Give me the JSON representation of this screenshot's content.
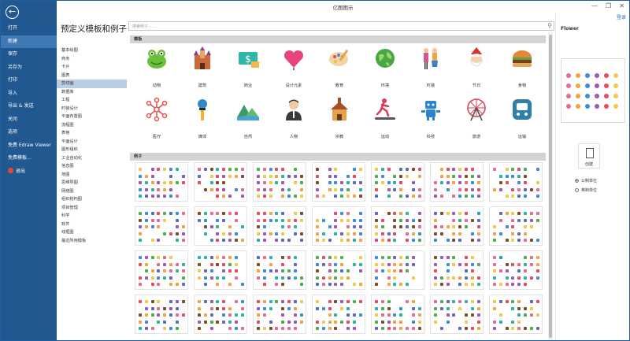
{
  "window": {
    "title": "亿图图示",
    "minimize_label": "—",
    "maximize_label": "❐",
    "close_label": "✕",
    "signin_label": "登录"
  },
  "sidebar": {
    "items": [
      {
        "label": "打开"
      },
      {
        "label": "新建",
        "selected": true
      },
      {
        "label": "保存"
      },
      {
        "label": "另存为"
      },
      {
        "label": "打印"
      },
      {
        "label": "导入"
      },
      {
        "label": "导出 & 发送"
      },
      {
        "label": "关闭"
      },
      {
        "label": "选项"
      },
      {
        "label": "免费 Edraw Viewer"
      },
      {
        "label": "免费模板..."
      },
      {
        "label": "退出"
      }
    ]
  },
  "categories": {
    "heading": "预定义模板和例子",
    "items": [
      "基本绘图",
      "商务",
      "卡片",
      "图表",
      "剪切画",
      "数据库",
      "工程",
      "时装设计",
      "平面布置图",
      "流程图",
      "表格",
      "平面设计",
      "图形组织",
      "工业自动化",
      "信息图",
      "地图",
      "思维导图",
      "网络图",
      "组织结构图",
      "项目管理",
      "科学",
      "软件",
      "线框图",
      "最近所用模板"
    ],
    "selected_index": 4
  },
  "search": {
    "placeholder": "搜索例子 . . ."
  },
  "templates": {
    "section_label": "模板",
    "items": [
      {
        "label": "动物",
        "icon": "frog-icon",
        "color": "#6cbf3b"
      },
      {
        "label": "建筑",
        "icon": "castle-icon",
        "color": "#c96a3c"
      },
      {
        "label": "商业",
        "icon": "money-icon",
        "color": "#2eb7a8"
      },
      {
        "label": "设计元素",
        "icon": "heart-icon",
        "color": "#e8457a"
      },
      {
        "label": "教育",
        "icon": "palette-icon",
        "color": "#f0a04a"
      },
      {
        "label": "环境",
        "icon": "globe-icon",
        "color": "#48a745"
      },
      {
        "label": "时装",
        "icon": "fashion-icon",
        "color": "#d2598a"
      },
      {
        "label": "节日",
        "icon": "santa-icon",
        "color": "#d8322e"
      },
      {
        "label": "食物",
        "icon": "burger-icon",
        "color": "#e28a3b"
      },
      {
        "label": "医疗",
        "icon": "molecule-icon",
        "color": "#e2534a"
      },
      {
        "label": "媒体",
        "icon": "microphone-icon",
        "color": "#2d8cc9"
      },
      {
        "label": "自然",
        "icon": "landscape-icon",
        "color": "#3b9b64"
      },
      {
        "label": "人物",
        "icon": "person-icon",
        "color": "#3a3a3a"
      },
      {
        "label": "宗教",
        "icon": "church-icon",
        "color": "#e6a24b"
      },
      {
        "label": "运动",
        "icon": "treadmill-icon",
        "color": "#d83b5c"
      },
      {
        "label": "科技",
        "icon": "robot-icon",
        "color": "#2a85d0"
      },
      {
        "label": "旅游",
        "icon": "ferris-wheel-icon",
        "color": "#d9455a"
      },
      {
        "label": "运输",
        "icon": "train-icon",
        "color": "#2f7fa8"
      }
    ]
  },
  "examples": {
    "section_label": "例子",
    "count": 28
  },
  "panel": {
    "title": "Flower",
    "create_label": "创建",
    "unit_options": [
      {
        "label": "公制单位",
        "selected": true
      },
      {
        "label": "英制单位",
        "selected": false
      }
    ]
  }
}
